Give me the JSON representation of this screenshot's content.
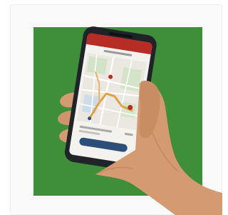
{
  "image": {
    "subject": "hand-holding-phone-with-map-app",
    "colors": {
      "background_square": "#3f8f3a",
      "app_header": "#b72c24",
      "phone_body": "#202327",
      "skin": "#d49a72",
      "skin_shadow": "#b97d57",
      "screen": "#f4f2ee",
      "route": "#e0a048",
      "map_green": "#cfe3c4",
      "map_water": "#c9dbe8",
      "app_button": "#2c4e78"
    }
  }
}
